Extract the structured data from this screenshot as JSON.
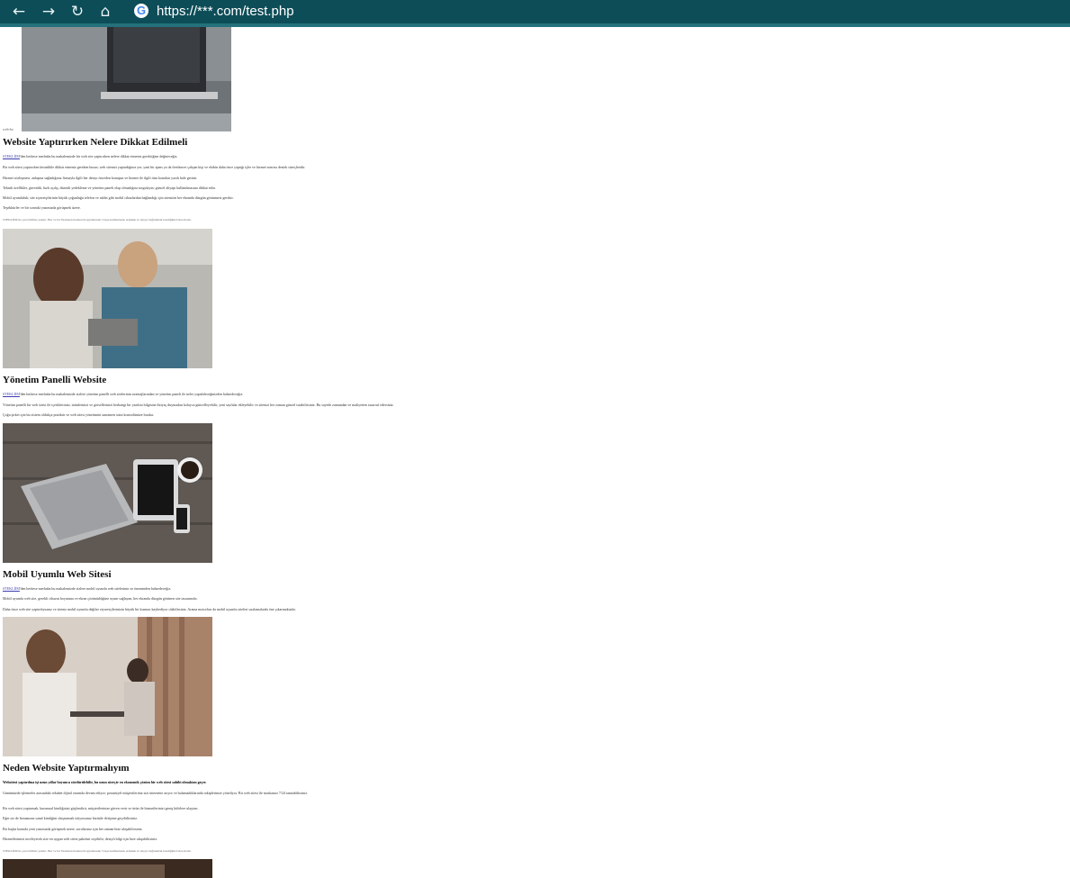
{
  "browser": {
    "back_icon": "back-arrow-icon",
    "forward_icon": "forward-arrow-icon",
    "reload_icon": "reload-icon",
    "home_icon": "home-icon",
    "site_icon": "google-icon",
    "url": "https://***.com/test.php"
  },
  "colors": {
    "browser_bar": "#0d4d58",
    "browser_bar_border": "#23717b"
  },
  "page": {
    "alt_fragment": "web-bo",
    "sections": [
      {
        "title": "Website Yaptırırken Nelere Dikkat Edilmeli",
        "paragraphs": [
          {
            "link": "STEKLİJM",
            "text": "'den herkese merhaba bu makalemizde bir web site yaptırırken nelere dikkat etmeniz gerektiğine değineceğiz."
          },
          {
            "text": "Bir web sitesi yaptırırken kesinlikle dikkat etmeniz gereken husus; web sitenizi yaptırdığınız yer, yani bir ajans ya da freelancer çalışan kişi ve ekibin daha önce yaptığı işler ve hizmet sonrası destek süreçleridir."
          },
          {
            "text": "Hizmet sözleşmesi, anlaşma sağladığınız firmayla ilgili her detayı önceden konuşun ve hizmet ile ilgili tüm konuları yazılı hale getirin."
          },
          {
            "text": "Teknik özellikler, güvenlik, hızlı açılış, düzenli yedekleme ve yönetim paneli olup olmadığını sorgulayın; güncel altyapı kullanılmasına dikkat edin."
          },
          {
            "text": "Mobil uyumluluk; site ziyaretçilerinin büyük çoğunluğu telefon ve tablet gibi mobil cihazlardan bağlandığı için sitenizin her ekranda düzgün görünmesi gerekir."
          },
          {
            "text": "Teşekkürler ve bir sonraki yazımızda görüşmek üzere."
          },
          {
            "small": true,
            "text": "STEKLİJM ile yazı birlikte yazılır. Her ve bu Yazarken Kutusu Kopyalanarak 5 tuşu kullanılarak erişmek ve siteye bağlanmak istediğinizi bize iletin."
          }
        ]
      },
      {
        "title": "Yönetim Panelli Website",
        "paragraphs": [
          {
            "link": "STEKLİJM",
            "text": "'den herkese merhaba bu makalemizde sizlere yönetim panelli web sitelerinin avantajlarından ve yönetim paneli ile neler yapabileceğinizden bahsedeceğiz."
          },
          {
            "text": "Yönetim panelli bir web sitesi ile içeriklerinizi, ürünlerinizi ve görsellerinizi herhangi bir yazılım bilgisine ihtiyaç duymadan kolayca güncelleyebilir, yeni sayfalar ekleyebilir ve sitenizi her zaman güncel tutabilirsiniz. Bu sayede zamandan ve maliyetten tasarruf edersiniz."
          },
          {
            "text": "Çoğu şirket için bu sistem oldukça pratiktir ve web sitesi yönetimini tamamen sizin kontrolünüze bırakır."
          }
        ]
      },
      {
        "title": "Mobil Uyumlu Web Sitesi",
        "paragraphs": [
          {
            "link": "STEKLİJM",
            "text": "'den herkese merhaba bu makalemizde sizlere mobil uyumlu web sitelerinin ve öneminden bahsedeceğiz."
          },
          {
            "text": "Mobil uyumlu web site, gerekli cihazın boyutuna ve ekran çözünürlüğüne uyum sağlayan, her ekranda düzgün görünen site tasarımıdır."
          },
          {
            "text": "Daha önce web site yaptırdıysanız ve siteniz mobil uyumlu değilse ziyaretçilerinizin büyük bir kısmını kaybediyor olabilirsiniz. Arama motorları da mobil uyumlu siteleri sıralamalarda öne çıkarmaktadır."
          }
        ]
      },
      {
        "title": "Neden Website Yaptırmalıyım",
        "paragraphs": [
          {
            "text": "Websitesi yaptırılma işi uzun yıllar boyunca sürdürülebilir, bu uzun süreçte en ekonomik çözüm bir web sitesi sahibi olmaktan geçer."
          },
          {
            "text": "Günümüzde işletmeler arasındaki rekabet dijital ortamda devam ediyor; potansiyel müşterileriniz sizi internette arıyor ve bulamadıklarında rakiplerinize yöneliyor. Bir web sitesi ile markanızı 7/24 tanıtabilirsiniz."
          },
          {
            "text": "Bir web sitesi yaptırmak, kurumsal kimliğinizi güçlendirir, müşterilerinize güven verir ve ürün ile hizmetlerinizi geniş kitlelere ulaştırır."
          },
          {
            "text": "Eğer siz de firmanızın sanal kimliğini oluşturmak istiyorsanız bizimle iletişime geçebilirsiniz."
          },
          {
            "text": "Bir başka konuda yeni yazımızda görüşmek üzere, sorularınız için her zaman bize ulaşabilirsiniz."
          },
          {
            "text": "Hizmetlerimizi inceleyerek size en uygun web sitesi paketini seçebilir, detaylı bilgi için bize ulaşabilirsiniz."
          },
          {
            "small": true,
            "text": "STEKLİJM ile yazı birlikte yazılır. Her ve bu Yazarken Kutusu Kopyalanarak 5 tuşu kullanılarak erişmek ve siteye bağlanmak istediğinizi bize iletin."
          }
        ]
      }
    ]
  }
}
